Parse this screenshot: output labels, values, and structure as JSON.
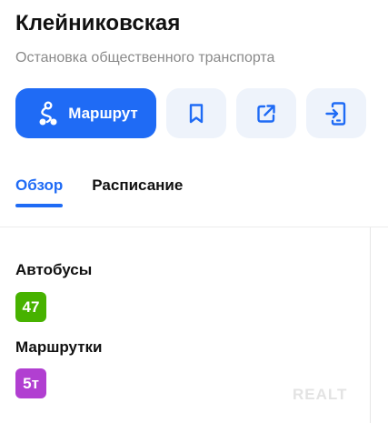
{
  "stop": {
    "title": "Клейниковская",
    "subtitle": "Остановка общественного транспорта"
  },
  "actions": {
    "route_label": "Маршрут",
    "icons": [
      "route-icon",
      "bookmark-icon",
      "share-icon",
      "send-to-phone-icon"
    ]
  },
  "tabs": [
    {
      "label": "Обзор",
      "active": true
    },
    {
      "label": "Расписание",
      "active": false
    }
  ],
  "sections": {
    "buses": {
      "title": "Автобусы",
      "routes": [
        {
          "number": "47",
          "color": "#47b200"
        }
      ]
    },
    "minibuses": {
      "title": "Маршрутки",
      "routes": [
        {
          "number": "5т",
          "color": "#b13fd1"
        }
      ]
    }
  },
  "colors": {
    "accent": "#1f6bf5",
    "icon_button_bg": "#eef3fb"
  },
  "watermark": "REALT"
}
